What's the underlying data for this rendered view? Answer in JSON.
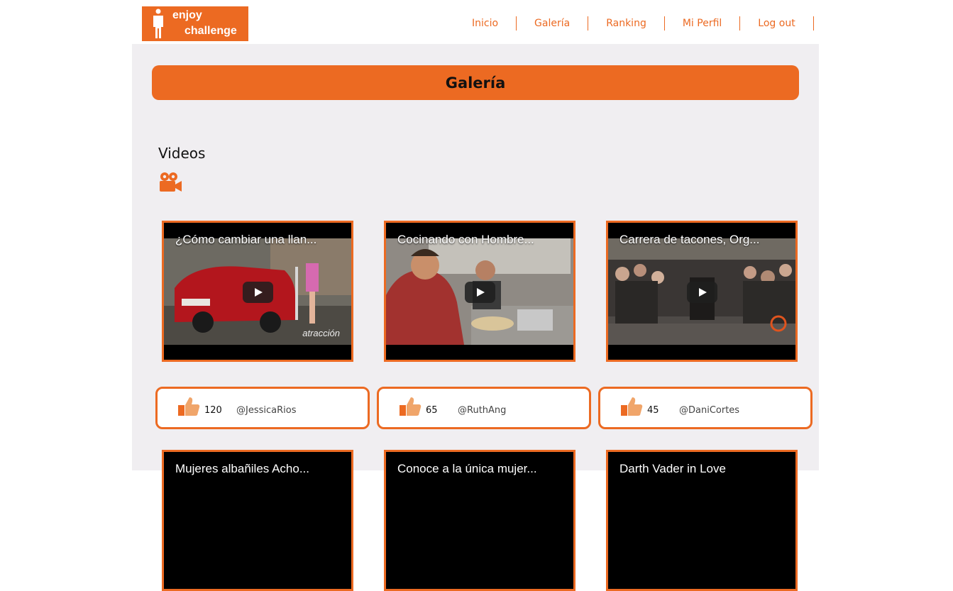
{
  "logo": {
    "line1": "enjoy",
    "line2": "challenge"
  },
  "nav": [
    "Inicio",
    "Galería",
    "Ranking",
    "Mi Perfil",
    "Log out"
  ],
  "page_title": "Galería",
  "section": {
    "title": "Videos",
    "icon": "video-camera-icon"
  },
  "colors": {
    "accent": "#ec6a22",
    "panel": "#f0eef1"
  },
  "videos": [
    {
      "title": "¿Cómo cambiar una llan...",
      "likes": "120",
      "user": "@JessicaRios",
      "brand": "atracción"
    },
    {
      "title": "Cocinando con Hombre...",
      "likes": "65",
      "user": "@RuthAng"
    },
    {
      "title": "Carrera de tacones, Org...",
      "likes": "45",
      "user": "@DaniCortes"
    },
    {
      "title": "Mujeres albañiles Acho..."
    },
    {
      "title": "Conoce a la única mujer..."
    },
    {
      "title": "Darth Vader in Love"
    }
  ]
}
